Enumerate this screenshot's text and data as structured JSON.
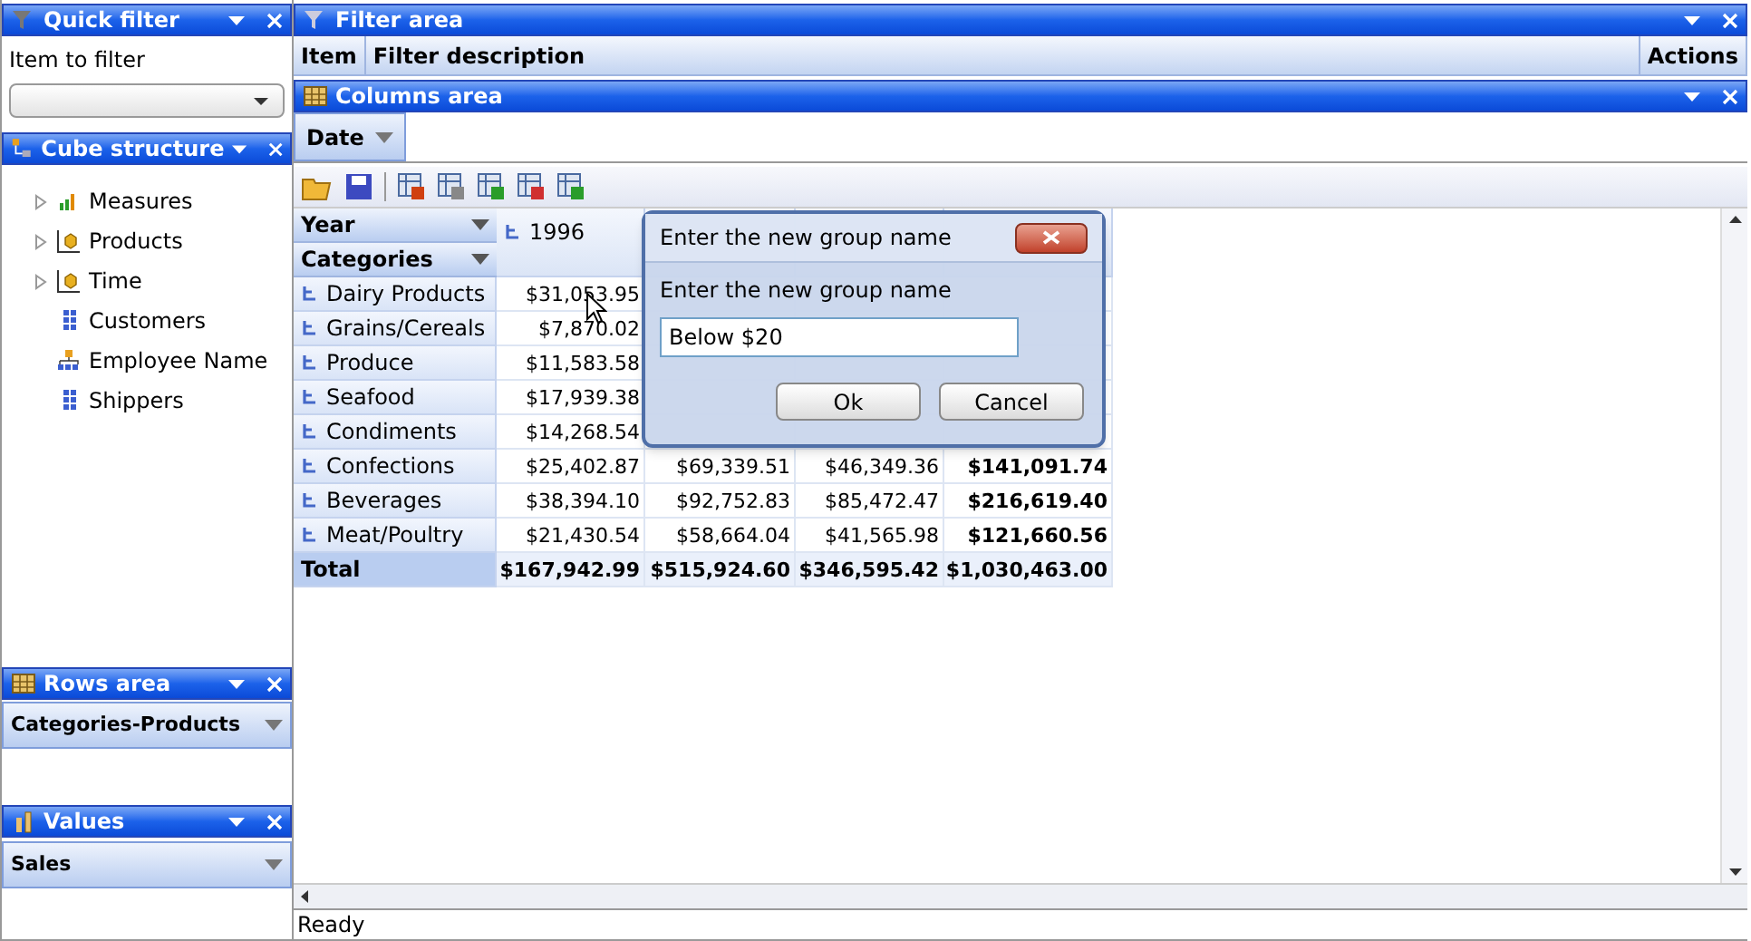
{
  "quick_filter": {
    "title": "Quick filter",
    "label": "Item to filter"
  },
  "cube_structure": {
    "title": "Cube structure",
    "items": [
      {
        "label": "Measures",
        "kind": "measures",
        "expanded": false
      },
      {
        "label": "Products",
        "kind": "hierarchy",
        "expanded": false
      },
      {
        "label": "Time",
        "kind": "hierarchy",
        "expanded": false
      },
      {
        "label": "Customers",
        "kind": "dimension"
      },
      {
        "label": "Employee Name",
        "kind": "parent_child"
      },
      {
        "label": "Shippers",
        "kind": "dimension"
      }
    ]
  },
  "rows_area": {
    "title": "Rows area",
    "fields": [
      "Categories-Products"
    ]
  },
  "values_area": {
    "title": "Values",
    "fields": [
      "Sales"
    ]
  },
  "filter_area": {
    "title": "Filter area",
    "columns": [
      "Item",
      "Filter description",
      "Actions"
    ]
  },
  "columns_area": {
    "title": "Columns area",
    "fields": [
      "Date"
    ]
  },
  "pivot": {
    "column_field": "Year",
    "row_field": "Categories",
    "column_headers": [
      "1996"
    ],
    "rows": [
      {
        "label": "Dairy Products",
        "values": [
          "$31,053.95"
        ]
      },
      {
        "label": "Grains/Cereals",
        "values": [
          "$7,870.02"
        ]
      },
      {
        "label": "Produce",
        "values": [
          "$11,583.58"
        ]
      },
      {
        "label": "Seafood",
        "values": [
          "$17,939.38"
        ]
      },
      {
        "label": "Condiments",
        "values": [
          "$14,268.54"
        ]
      },
      {
        "label": "Confections",
        "values": [
          "$25,402.87",
          "$69,339.51",
          "$46,349.36",
          "$141,091.74"
        ]
      },
      {
        "label": "Beverages",
        "values": [
          "$38,394.10",
          "$92,752.83",
          "$85,472.47",
          "$216,619.40"
        ]
      },
      {
        "label": "Meat/Poultry",
        "values": [
          "$21,430.54",
          "$58,664.04",
          "$41,565.98",
          "$121,660.56"
        ]
      }
    ],
    "total": {
      "label": "Total",
      "values": [
        "$167,942.99",
        "$515,924.60",
        "$346,595.42",
        "$1,030,463.00"
      ]
    }
  },
  "dialog": {
    "title": "Enter the new group name",
    "prompt": "Enter the new group name",
    "value": "Below $20",
    "buttons": [
      "Ok",
      "Cancel"
    ]
  },
  "status_bar": "Ready"
}
